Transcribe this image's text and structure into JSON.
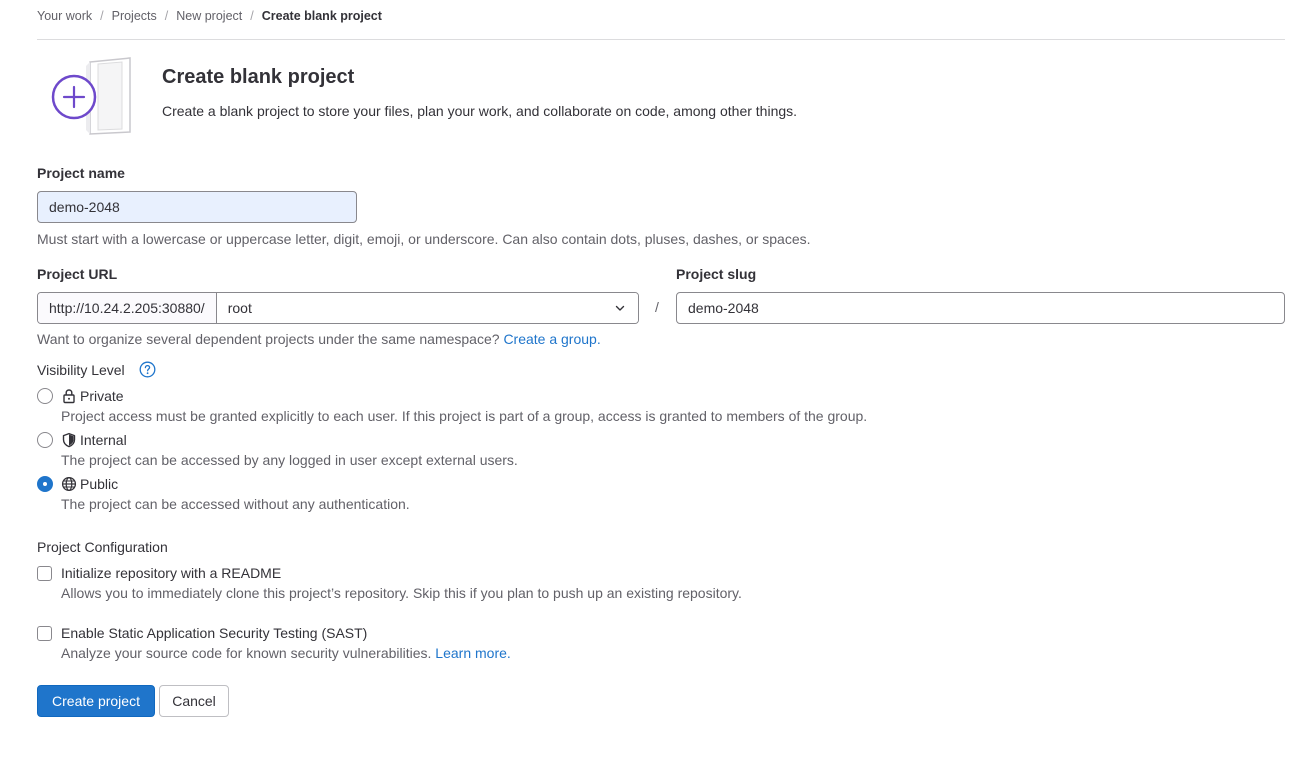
{
  "breadcrumb": [
    {
      "label": "Your work"
    },
    {
      "label": "Projects"
    },
    {
      "label": "New project"
    },
    {
      "label": "Create blank project"
    }
  ],
  "header": {
    "title": "Create blank project",
    "description": "Create a blank project to store your files, plan your work, and collaborate on code, among other things.",
    "illustration_icon": "blank-project-plus-icon"
  },
  "project_name": {
    "label": "Project name",
    "value": "demo-2048",
    "help": "Must start with a lowercase or uppercase letter, digit, emoji, or underscore. Can also contain dots, pluses, dashes, or spaces."
  },
  "project_url": {
    "label": "Project URL",
    "prefix": "http://10.24.2.205:30880/",
    "namespace": "root",
    "separator": "/"
  },
  "project_slug": {
    "label": "Project slug",
    "value": "demo-2048"
  },
  "group_help": {
    "text": "Want to organize several dependent projects under the same namespace?",
    "link": "Create a group."
  },
  "visibility": {
    "label": "Visibility Level",
    "selected": "public",
    "options": [
      {
        "id": "private",
        "label": "Private",
        "icon": "lock-icon",
        "description": "Project access must be granted explicitly to each user. If this project is part of a group, access is granted to members of the group."
      },
      {
        "id": "internal",
        "label": "Internal",
        "icon": "shield-icon",
        "description": "The project can be accessed by any logged in user except external users."
      },
      {
        "id": "public",
        "label": "Public",
        "icon": "globe-icon",
        "description": "The project can be accessed without any authentication."
      }
    ]
  },
  "configuration": {
    "label": "Project Configuration",
    "readme": {
      "label": "Initialize repository with a README",
      "description": "Allows you to immediately clone this project’s repository. Skip this if you plan to push up an existing repository.",
      "checked": false
    },
    "sast": {
      "label": "Enable Static Application Security Testing (SAST)",
      "description": "Analyze your source code for known security vulnerabilities.",
      "link": "Learn more.",
      "checked": false
    }
  },
  "actions": {
    "create": "Create project",
    "cancel": "Cancel"
  },
  "colors": {
    "primary": "#1f75cb",
    "text": "#333238",
    "muted": "#626168",
    "border": "#89888d",
    "autofill": "#e8f0fe",
    "illustration_accent": "#6e49cb"
  }
}
